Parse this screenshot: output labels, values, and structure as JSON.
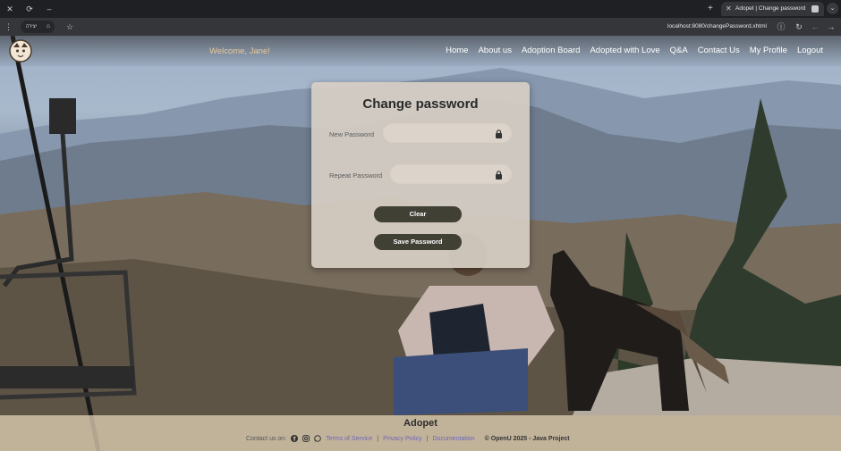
{
  "browser": {
    "tab_title": "Adopet | Change password",
    "pill_label": "יצירה",
    "url": "localhost:8080/changePassword.xhtml"
  },
  "nav": {
    "welcome": "Welcome, Jane!",
    "items": [
      {
        "label": "Home"
      },
      {
        "label": "About us"
      },
      {
        "label": "Adoption Board"
      },
      {
        "label": "Adopted with Love"
      },
      {
        "label": "Q&A"
      },
      {
        "label": "Contact Us"
      },
      {
        "label": "My Profile"
      },
      {
        "label": "Logout"
      }
    ]
  },
  "form": {
    "title": "Change password",
    "new_password_label": "New Password",
    "new_password_value": "",
    "repeat_password_label": "Repeat Password",
    "repeat_password_value": "",
    "clear_label": "Clear",
    "save_label": "Save Password"
  },
  "footer": {
    "brand": "Adopet",
    "contact_label": "Contact us on:",
    "terms": "Terms of Service",
    "privacy": "Privacy Policy",
    "docs": "Documentation",
    "copyright": "© OpenU 2025 - Java Project"
  },
  "colors": {
    "welcome": "#e9c79a",
    "button": "#404035",
    "card": "#d6cec4",
    "footer_link": "#6f66b8"
  }
}
